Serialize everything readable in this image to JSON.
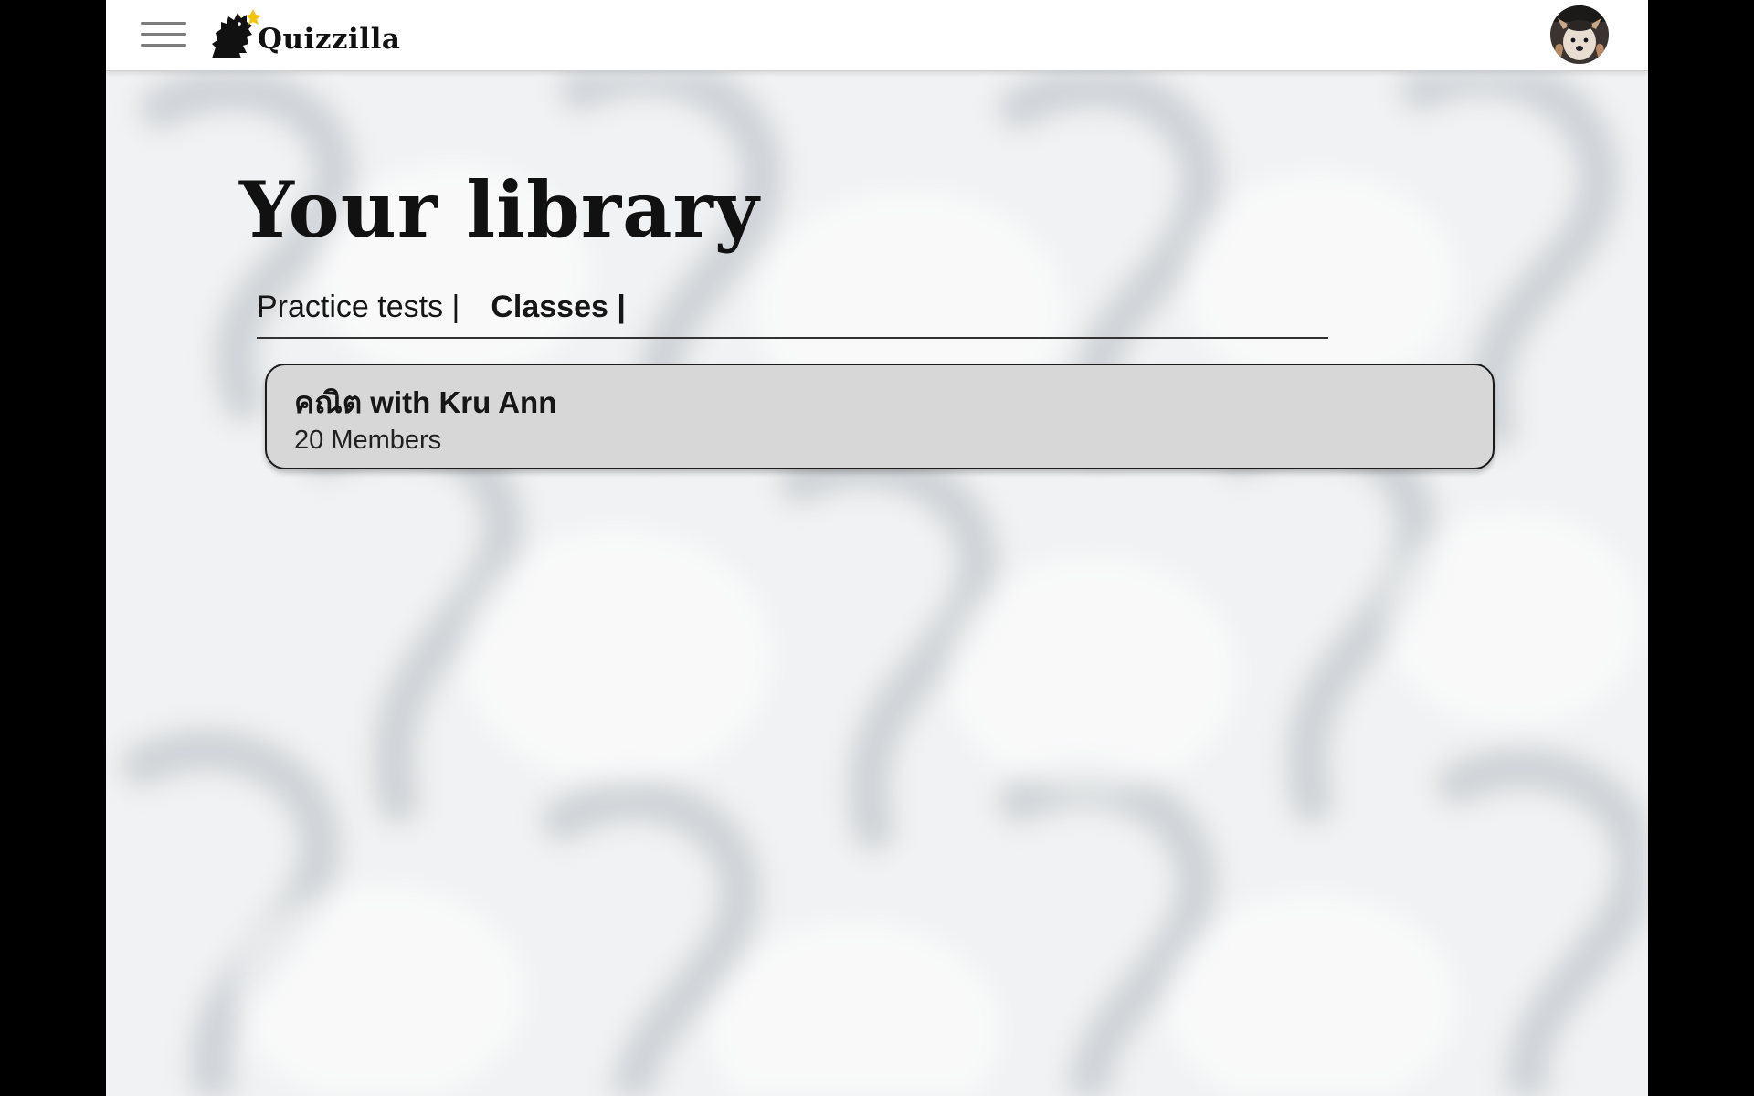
{
  "app": {
    "name": "Quizzilla",
    "menu_icon": "hamburger-menu-icon",
    "logo_icon": "godzilla-logo-icon",
    "avatar_icon": "user-avatar-dog-photo"
  },
  "page": {
    "title": "Your library"
  },
  "tabs": [
    {
      "label": "Practice tests |",
      "active": false
    },
    {
      "label": "Classes |",
      "active": true
    }
  ],
  "classes": [
    {
      "name": "คณิต with Kru Ann",
      "members": "20 Members"
    }
  ],
  "colors": {
    "topbar": "#ffffff",
    "background": "#f1f2f3",
    "card_fill": "#d7d7d7",
    "card_border": "#1a1a1a",
    "text": "#161616",
    "logo_accent": "#f2c500"
  }
}
